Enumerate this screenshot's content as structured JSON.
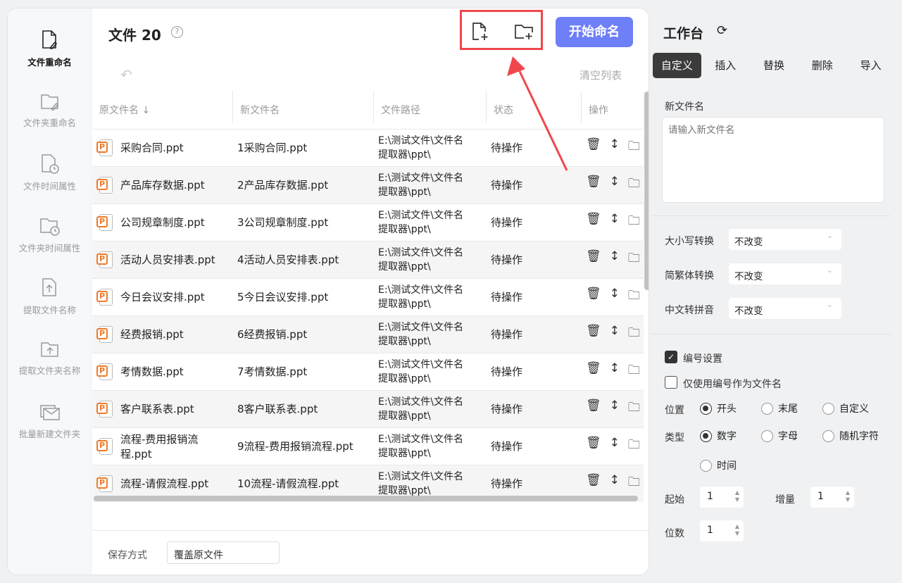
{
  "sidebar": {
    "items": [
      {
        "label": "文件重命名",
        "icon": "file-edit-icon"
      },
      {
        "label": "文件夹重命名",
        "icon": "folder-edit-icon"
      },
      {
        "label": "文件时间属性",
        "icon": "file-clock-icon"
      },
      {
        "label": "文件夹时间属性",
        "icon": "folder-clock-icon"
      },
      {
        "label": "提取文件名称",
        "icon": "file-upload-icon"
      },
      {
        "label": "提取文件夹名称",
        "icon": "folder-upload-icon"
      },
      {
        "label": "批量新建文件夹",
        "icon": "folders-icon"
      }
    ]
  },
  "header": {
    "title": "文件 20",
    "start_label": "开始命名",
    "clear_label": "清空列表",
    "help": "?"
  },
  "table": {
    "columns": [
      "原文件名 ↓",
      "新文件名",
      "文件路径",
      "状态",
      "操作"
    ],
    "rows": [
      {
        "orig": "采购合同.ppt",
        "new": "1采购合同.ppt",
        "path1": "E:\\测试文件\\文件名",
        "path2": "提取器\\ppt\\",
        "status": "待操作"
      },
      {
        "orig": "产品库存数据.ppt",
        "new": "2产品库存数据.ppt",
        "path1": "E:\\测试文件\\文件名",
        "path2": "提取器\\ppt\\",
        "status": "待操作"
      },
      {
        "orig": "公司规章制度.ppt",
        "new": "3公司规章制度.ppt",
        "path1": "E:\\测试文件\\文件名",
        "path2": "提取器\\ppt\\",
        "status": "待操作"
      },
      {
        "orig": "活动人员安排表.ppt",
        "new": "4活动人员安排表.ppt",
        "path1": "E:\\测试文件\\文件名",
        "path2": "提取器\\ppt\\",
        "status": "待操作"
      },
      {
        "orig": "今日会议安排.ppt",
        "new": "5今日会议安排.ppt",
        "path1": "E:\\测试文件\\文件名",
        "path2": "提取器\\ppt\\",
        "status": "待操作"
      },
      {
        "orig": "经费报销.ppt",
        "new": "6经费报销.ppt",
        "path1": "E:\\测试文件\\文件名",
        "path2": "提取器\\ppt\\",
        "status": "待操作"
      },
      {
        "orig": "考情数据.ppt",
        "new": "7考情数据.ppt",
        "path1": "E:\\测试文件\\文件名",
        "path2": "提取器\\ppt\\",
        "status": "待操作"
      },
      {
        "orig": "客户联系表.ppt",
        "new": "8客户联系表.ppt",
        "path1": "E:\\测试文件\\文件名",
        "path2": "提取器\\ppt\\",
        "status": "待操作"
      },
      {
        "orig": "流程-费用报销流程.ppt",
        "new": "9流程-费用报销流程.ppt",
        "path1": "E:\\测试文件\\文件名",
        "path2": "提取器\\ppt\\",
        "status": "待操作"
      },
      {
        "orig": "流程-请假流程.ppt",
        "new": "10流程-请假流程.ppt",
        "path1": "E:\\测试文件\\文件名",
        "path2": "提取器\\ppt\\",
        "status": "待操作"
      }
    ]
  },
  "footer": {
    "save_label": "保存方式",
    "save_value": "覆盖原文件"
  },
  "workbench": {
    "title": "工作台",
    "tabs": [
      "自定义",
      "插入",
      "替换",
      "删除",
      "导入"
    ],
    "new_name_label": "新文件名",
    "new_name_placeholder": "请输入新文件名",
    "case_label": "大小写转换",
    "case_value": "不改变",
    "trad_label": "简繁体转换",
    "trad_value": "不改变",
    "pinyin_label": "中文转拼音",
    "pinyin_value": "不改变",
    "numbering_label": "编号设置",
    "numbering_checked": true,
    "only_number_label": "仅使用编号作为文件名",
    "only_number_checked": false,
    "position_label": "位置",
    "position_options": [
      "开头",
      "末尾",
      "自定义"
    ],
    "position_selected": "开头",
    "type_label": "类型",
    "type_options": [
      "数字",
      "字母",
      "随机字符",
      "时间"
    ],
    "type_selected": "数字",
    "start_label": "起始",
    "start_value": "1",
    "increment_label": "增量",
    "increment_value": "1",
    "digits_label": "位数",
    "digits_value": "1"
  },
  "colors": {
    "accent": "#6e7ff8",
    "highlight": "#f0474d",
    "ppt": "#f07a2a"
  }
}
